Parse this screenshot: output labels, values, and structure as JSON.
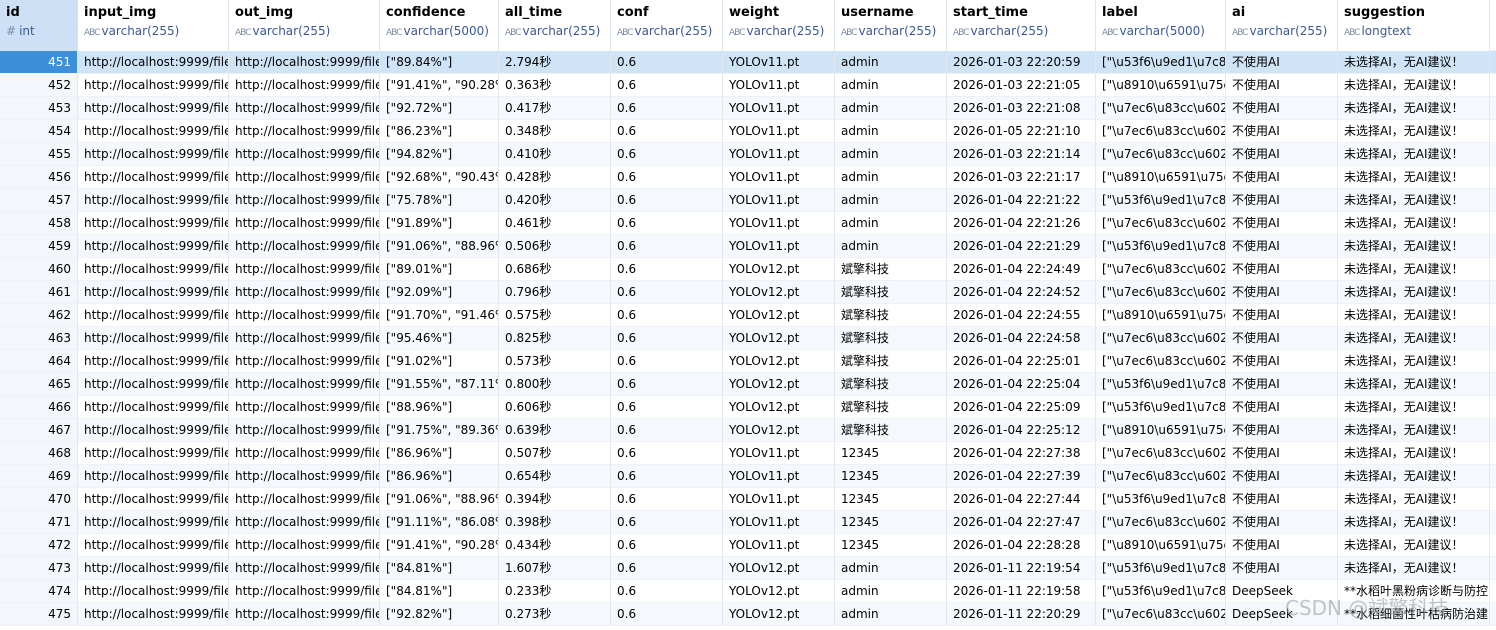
{
  "columns": [
    {
      "name": "id",
      "type": "int",
      "type_icon": "#",
      "w": 78
    },
    {
      "name": "input_img",
      "type": "varchar(255)",
      "type_icon": "ABC",
      "w": 151
    },
    {
      "name": "out_img",
      "type": "varchar(255)",
      "type_icon": "ABC",
      "w": 151
    },
    {
      "name": "confidence",
      "type": "varchar(5000)",
      "type_icon": "ABC",
      "w": 119
    },
    {
      "name": "all_time",
      "type": "varchar(255)",
      "type_icon": "ABC",
      "w": 112
    },
    {
      "name": "conf",
      "type": "varchar(255)",
      "type_icon": "ABC",
      "w": 112
    },
    {
      "name": "weight",
      "type": "varchar(255)",
      "type_icon": "ABC",
      "w": 112
    },
    {
      "name": "username",
      "type": "varchar(255)",
      "type_icon": "ABC",
      "w": 112
    },
    {
      "name": "start_time",
      "type": "varchar(255)",
      "type_icon": "ABC",
      "w": 149
    },
    {
      "name": "label",
      "type": "varchar(5000)",
      "type_icon": "ABC",
      "w": 130
    },
    {
      "name": "ai",
      "type": "varchar(255)",
      "type_icon": "ABC",
      "w": 112
    },
    {
      "name": "suggestion",
      "type": "longtext",
      "type_icon": "ABC",
      "w": 152
    }
  ],
  "rows": [
    [
      "451",
      "http://localhost:9999/file",
      "http://localhost:9999/file",
      "[\"89.84%\"]",
      "2.794秒",
      "0.6",
      "YOLOv11.pt",
      "admin",
      "2026-01-03 22:20:59",
      "[\"\\u53f6\\u9ed1\\u7c8",
      "不使用AI",
      "未选择AI，无AI建议！"
    ],
    [
      "452",
      "http://localhost:9999/file",
      "http://localhost:9999/file",
      "[\"91.41%\", \"90.28%",
      "0.363秒",
      "0.6",
      "YOLOv11.pt",
      "admin",
      "2026-01-03 22:21:05",
      "[\"\\u8910\\u6591\\u75c",
      "不使用AI",
      "未选择AI，无AI建议！"
    ],
    [
      "453",
      "http://localhost:9999/file",
      "http://localhost:9999/file",
      "[\"92.72%\"]",
      "0.417秒",
      "0.6",
      "YOLOv11.pt",
      "admin",
      "2026-01-03 22:21:08",
      "[\"\\u7ec6\\u83cc\\u602",
      "不使用AI",
      "未选择AI，无AI建议！"
    ],
    [
      "454",
      "http://localhost:9999/file",
      "http://localhost:9999/file",
      "[\"86.23%\"]",
      "0.348秒",
      "0.6",
      "YOLOv11.pt",
      "admin",
      "2026-01-05 22:21:10",
      "[\"\\u7ec6\\u83cc\\u602",
      "不使用AI",
      "未选择AI，无AI建议！"
    ],
    [
      "455",
      "http://localhost:9999/file",
      "http://localhost:9999/file",
      "[\"94.82%\"]",
      "0.410秒",
      "0.6",
      "YOLOv11.pt",
      "admin",
      "2026-01-03 22:21:14",
      "[\"\\u7ec6\\u83cc\\u602",
      "不使用AI",
      "未选择AI，无AI建议！"
    ],
    [
      "456",
      "http://localhost:9999/file",
      "http://localhost:9999/file",
      "[\"92.68%\", \"90.43%",
      "0.428秒",
      "0.6",
      "YOLOv11.pt",
      "admin",
      "2026-01-03 22:21:17",
      "[\"\\u8910\\u6591\\u75c",
      "不使用AI",
      "未选择AI，无AI建议！"
    ],
    [
      "457",
      "http://localhost:9999/file",
      "http://localhost:9999/file",
      "[\"75.78%\"]",
      "0.420秒",
      "0.6",
      "YOLOv11.pt",
      "admin",
      "2026-01-04 22:21:22",
      "[\"\\u53f6\\u9ed1\\u7c8",
      "不使用AI",
      "未选择AI，无AI建议！"
    ],
    [
      "458",
      "http://localhost:9999/file",
      "http://localhost:9999/file",
      "[\"91.89%\"]",
      "0.461秒",
      "0.6",
      "YOLOv11.pt",
      "admin",
      "2026-01-04 22:21:26",
      "[\"\\u7ec6\\u83cc\\u602",
      "不使用AI",
      "未选择AI，无AI建议！"
    ],
    [
      "459",
      "http://localhost:9999/file",
      "http://localhost:9999/file",
      "[\"91.06%\", \"88.96%",
      "0.506秒",
      "0.6",
      "YOLOv11.pt",
      "admin",
      "2026-01-04 22:21:29",
      "[\"\\u53f6\\u9ed1\\u7c8",
      "不使用AI",
      "未选择AI，无AI建议！"
    ],
    [
      "460",
      "http://localhost:9999/file",
      "http://localhost:9999/file",
      "[\"89.01%\"]",
      "0.686秒",
      "0.6",
      "YOLOv12.pt",
      "斌擎科技",
      "2026-01-04 22:24:49",
      "[\"\\u7ec6\\u83cc\\u602",
      "不使用AI",
      "未选择AI，无AI建议！"
    ],
    [
      "461",
      "http://localhost:9999/file",
      "http://localhost:9999/file",
      "[\"92.09%\"]",
      "0.796秒",
      "0.6",
      "YOLOv12.pt",
      "斌擎科技",
      "2026-01-04 22:24:52",
      "[\"\\u7ec6\\u83cc\\u602",
      "不使用AI",
      "未选择AI，无AI建议！"
    ],
    [
      "462",
      "http://localhost:9999/file",
      "http://localhost:9999/file",
      "[\"91.70%\", \"91.46%",
      "0.575秒",
      "0.6",
      "YOLOv12.pt",
      "斌擎科技",
      "2026-01-04 22:24:55",
      "[\"\\u8910\\u6591\\u75c",
      "不使用AI",
      "未选择AI，无AI建议！"
    ],
    [
      "463",
      "http://localhost:9999/file",
      "http://localhost:9999/file",
      "[\"95.46%\"]",
      "0.825秒",
      "0.6",
      "YOLOv12.pt",
      "斌擎科技",
      "2026-01-04 22:24:58",
      "[\"\\u7ec6\\u83cc\\u602",
      "不使用AI",
      "未选择AI，无AI建议！"
    ],
    [
      "464",
      "http://localhost:9999/file",
      "http://localhost:9999/file",
      "[\"91.02%\"]",
      "0.573秒",
      "0.6",
      "YOLOv12.pt",
      "斌擎科技",
      "2026-01-04 22:25:01",
      "[\"\\u7ec6\\u83cc\\u602",
      "不使用AI",
      "未选择AI，无AI建议！"
    ],
    [
      "465",
      "http://localhost:9999/file",
      "http://localhost:9999/file",
      "[\"91.55%\", \"87.11%",
      "0.800秒",
      "0.6",
      "YOLOv12.pt",
      "斌擎科技",
      "2026-01-04 22:25:04",
      "[\"\\u53f6\\u9ed1\\u7c8",
      "不使用AI",
      "未选择AI，无AI建议！"
    ],
    [
      "466",
      "http://localhost:9999/file",
      "http://localhost:9999/file",
      "[\"88.96%\"]",
      "0.606秒",
      "0.6",
      "YOLOv12.pt",
      "斌擎科技",
      "2026-01-04 22:25:09",
      "[\"\\u53f6\\u9ed1\\u7c8",
      "不使用AI",
      "未选择AI，无AI建议！"
    ],
    [
      "467",
      "http://localhost:9999/file",
      "http://localhost:9999/file",
      "[\"91.75%\", \"89.36%",
      "0.639秒",
      "0.6",
      "YOLOv12.pt",
      "斌擎科技",
      "2026-01-04 22:25:12",
      "[\"\\u8910\\u6591\\u75c",
      "不使用AI",
      "未选择AI，无AI建议！"
    ],
    [
      "468",
      "http://localhost:9999/file",
      "http://localhost:9999/file",
      "[\"86.96%\"]",
      "0.507秒",
      "0.6",
      "YOLOv11.pt",
      "12345",
      "2026-01-04 22:27:38",
      "[\"\\u7ec6\\u83cc\\u602",
      "不使用AI",
      "未选择AI，无AI建议！"
    ],
    [
      "469",
      "http://localhost:9999/file",
      "http://localhost:9999/file",
      "[\"86.96%\"]",
      "0.654秒",
      "0.6",
      "YOLOv11.pt",
      "12345",
      "2026-01-04 22:27:39",
      "[\"\\u7ec6\\u83cc\\u602",
      "不使用AI",
      "未选择AI，无AI建议！"
    ],
    [
      "470",
      "http://localhost:9999/file",
      "http://localhost:9999/file",
      "[\"91.06%\", \"88.96%",
      "0.394秒",
      "0.6",
      "YOLOv11.pt",
      "12345",
      "2026-01-04 22:27:44",
      "[\"\\u53f6\\u9ed1\\u7c8",
      "不使用AI",
      "未选择AI，无AI建议！"
    ],
    [
      "471",
      "http://localhost:9999/file",
      "http://localhost:9999/file",
      "[\"91.11%\", \"86.08%",
      "0.398秒",
      "0.6",
      "YOLOv11.pt",
      "12345",
      "2026-01-04 22:27:47",
      "[\"\\u7ec6\\u83cc\\u602",
      "不使用AI",
      "未选择AI，无AI建议！"
    ],
    [
      "472",
      "http://localhost:9999/file",
      "http://localhost:9999/file",
      "[\"91.41%\", \"90.28%",
      "0.434秒",
      "0.6",
      "YOLOv11.pt",
      "12345",
      "2026-01-04 22:28:28",
      "[\"\\u8910\\u6591\\u75c",
      "不使用AI",
      "未选择AI，无AI建议！"
    ],
    [
      "473",
      "http://localhost:9999/file",
      "http://localhost:9999/file",
      "[\"84.81%\"]",
      "1.607秒",
      "0.6",
      "YOLOv12.pt",
      "admin",
      "2026-01-11 22:19:54",
      "[\"\\u53f6\\u9ed1\\u7c8",
      "不使用AI",
      "未选择AI，无AI建议！"
    ],
    [
      "474",
      "http://localhost:9999/file",
      "http://localhost:9999/file",
      "[\"84.81%\"]",
      "0.233秒",
      "0.6",
      "YOLOv12.pt",
      "admin",
      "2026-01-11 22:19:58",
      "[\"\\u53f6\\u9ed1\\u7c8",
      "DeepSeek",
      "**水稻叶黑粉病诊断与防控"
    ],
    [
      "475",
      "http://localhost:9999/file",
      "http://localhost:9999/file",
      "[\"92.82%\"]",
      "0.273秒",
      "0.6",
      "YOLOv12.pt",
      "admin",
      "2026-01-11 22:20:29",
      "[\"\\u7ec6\\u83cc\\u602",
      "DeepSeek",
      "**水稻细菌性叶枯病防治建"
    ]
  ],
  "selected_row": 0,
  "watermark": "CSDN @斌擎科技"
}
